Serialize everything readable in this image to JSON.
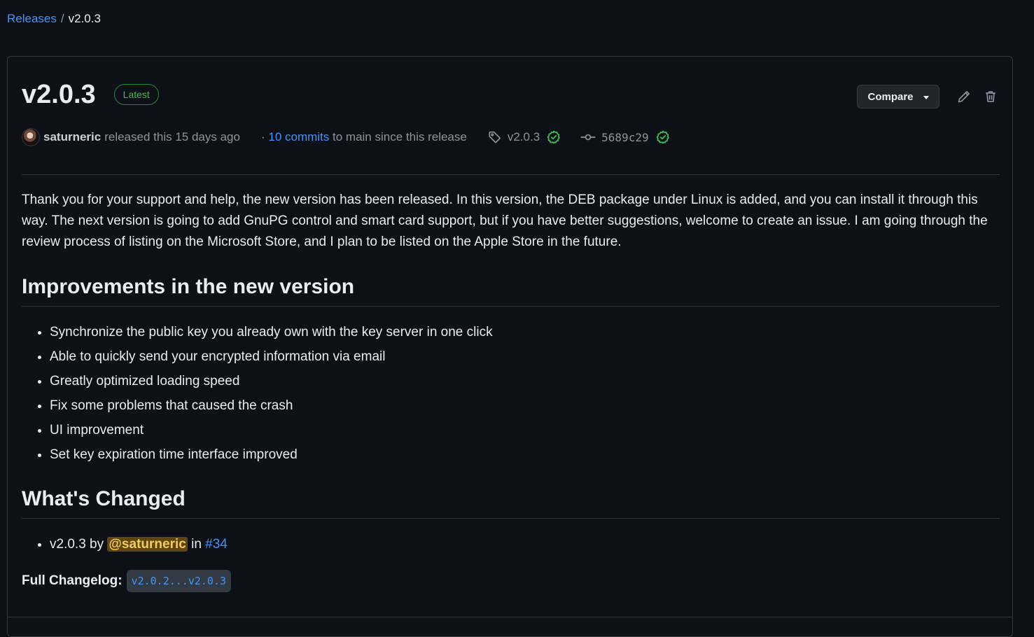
{
  "breadcrumb": {
    "parent": "Releases",
    "separator": "/",
    "current": "v2.0.3"
  },
  "release": {
    "title": "v2.0.3",
    "badge": "Latest",
    "compare_label": "Compare",
    "author": "saturneric",
    "released_text": "released this 15 days ago",
    "commits_prefix": "·",
    "commits_link": "10 commits",
    "commits_suffix": "to main since this release",
    "tag": "v2.0.3",
    "commit_sha": "5689c29",
    "intro": "Thank you for your support and help, the new version has been released. In this version, the DEB package under Linux is added, and you can install it through this way. The next version is going to add GnuPG control and smart card support, but if you have better suggestions, welcome to create an issue. I am going through the review process of listing on the Microsoft Store, and I plan to be listed on the Apple Store in the future."
  },
  "improvements": {
    "heading": "Improvements in the new version",
    "items": [
      "Synchronize the public key you already own with the key server in one click",
      "Able to quickly send your encrypted information via email",
      "Greatly optimized loading speed",
      "Fix some problems that caused the crash",
      "UI improvement",
      "Set key expiration time interface improved"
    ]
  },
  "changes": {
    "heading": "What's Changed",
    "item_version": "v2.0.3",
    "item_by": "by",
    "item_mention": "@saturneric",
    "item_in": "in",
    "item_pr": "#34"
  },
  "changelog": {
    "label": "Full Changelog:",
    "range": "v2.0.2...v2.0.3"
  },
  "colors": {
    "background": "#0d1117",
    "link": "#4493f8",
    "success": "#3fb950",
    "border": "#30363d"
  },
  "icons": [
    "pencil-icon",
    "trash-icon",
    "tag-icon",
    "check-circle-icon",
    "git-commit-icon",
    "chevron-down-icon"
  ]
}
